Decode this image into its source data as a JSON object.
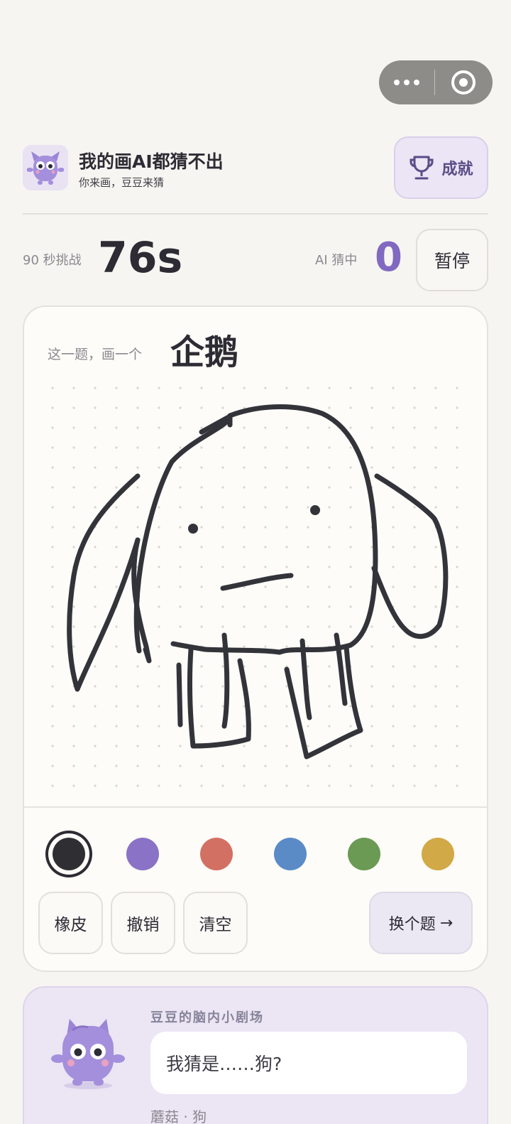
{
  "app": {
    "title": "我的画AI都猜不出",
    "subtitle": "你来画，豆豆来猜",
    "logo_icon": "purple-monster-mascot",
    "achievements_label": "成就",
    "achievements_icon": "trophy-icon"
  },
  "capsule": {
    "more_icon": "more-dots-icon",
    "close_icon": "target-circle-icon"
  },
  "stats": {
    "timer_label": "90 秒挑战",
    "timer_value": "76s",
    "ai_label": "AI 猜中",
    "ai_value": "0",
    "pause_label": "暂停"
  },
  "prompt": {
    "label": "这一题，画一个",
    "word": "企鹅"
  },
  "palette": {
    "colors": [
      "#2f2f33",
      "#8a72c6",
      "#d27063",
      "#5a8bc7",
      "#6a9a54",
      "#d2a947"
    ],
    "selected": "#2f2f33"
  },
  "tools": {
    "eraser": "橡皮",
    "undo": "撤销",
    "clear": "清空",
    "next": "换个题",
    "next_arrow": "→"
  },
  "theater": {
    "title": "豆豆的脑内小剧场",
    "guess": "我猜是……狗?",
    "history": "蘑菇 · 狗"
  },
  "colors": {
    "accent": "#8168c0",
    "background": "#f6f5f1",
    "card": "#fdfcf8",
    "lavender": "#ebe5f4"
  }
}
